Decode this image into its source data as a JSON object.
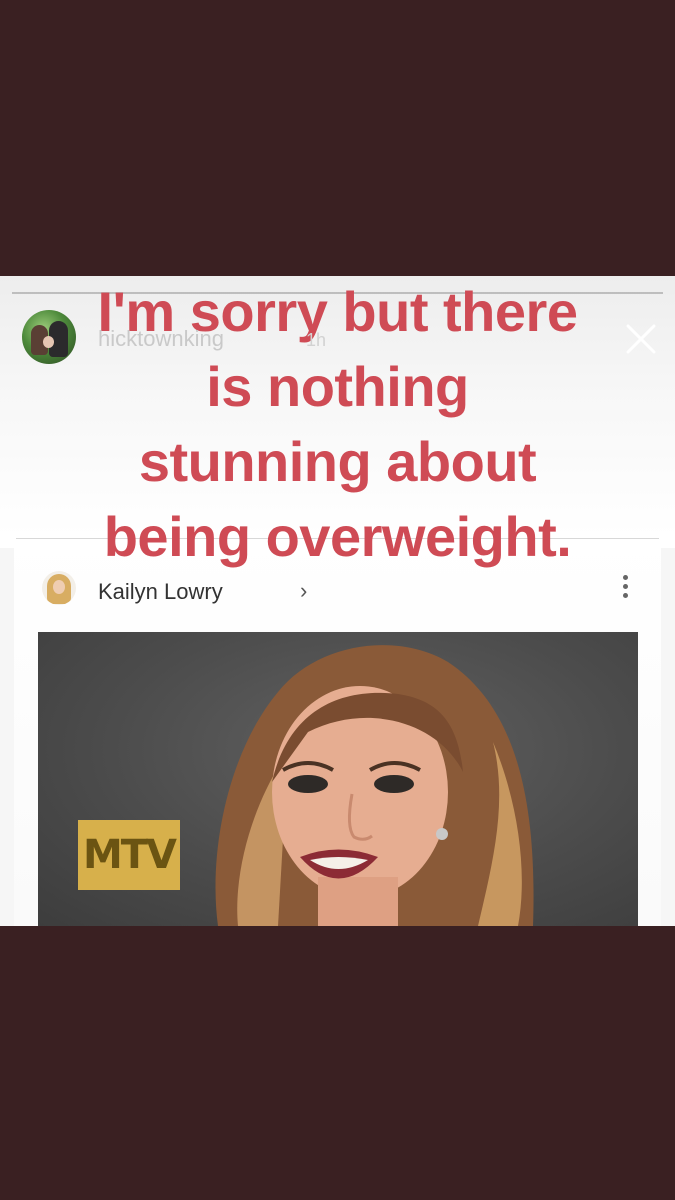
{
  "story": {
    "username": "hicktownking",
    "timestamp": "1h",
    "caption_lines": [
      "I'm sorry but there",
      "is nothing",
      "stunning about",
      "being overweight."
    ],
    "icons": {
      "close": "close-icon",
      "avatar": "profile-avatar"
    }
  },
  "post": {
    "author": "Kailyn Lowry",
    "chevron": "›",
    "more_icon": "more-dots-icon",
    "photo_logo_text": "MTV"
  },
  "colors": {
    "background": "#3a2022",
    "caption": "#cf4b55",
    "logo_gold": "#d7b04b"
  }
}
